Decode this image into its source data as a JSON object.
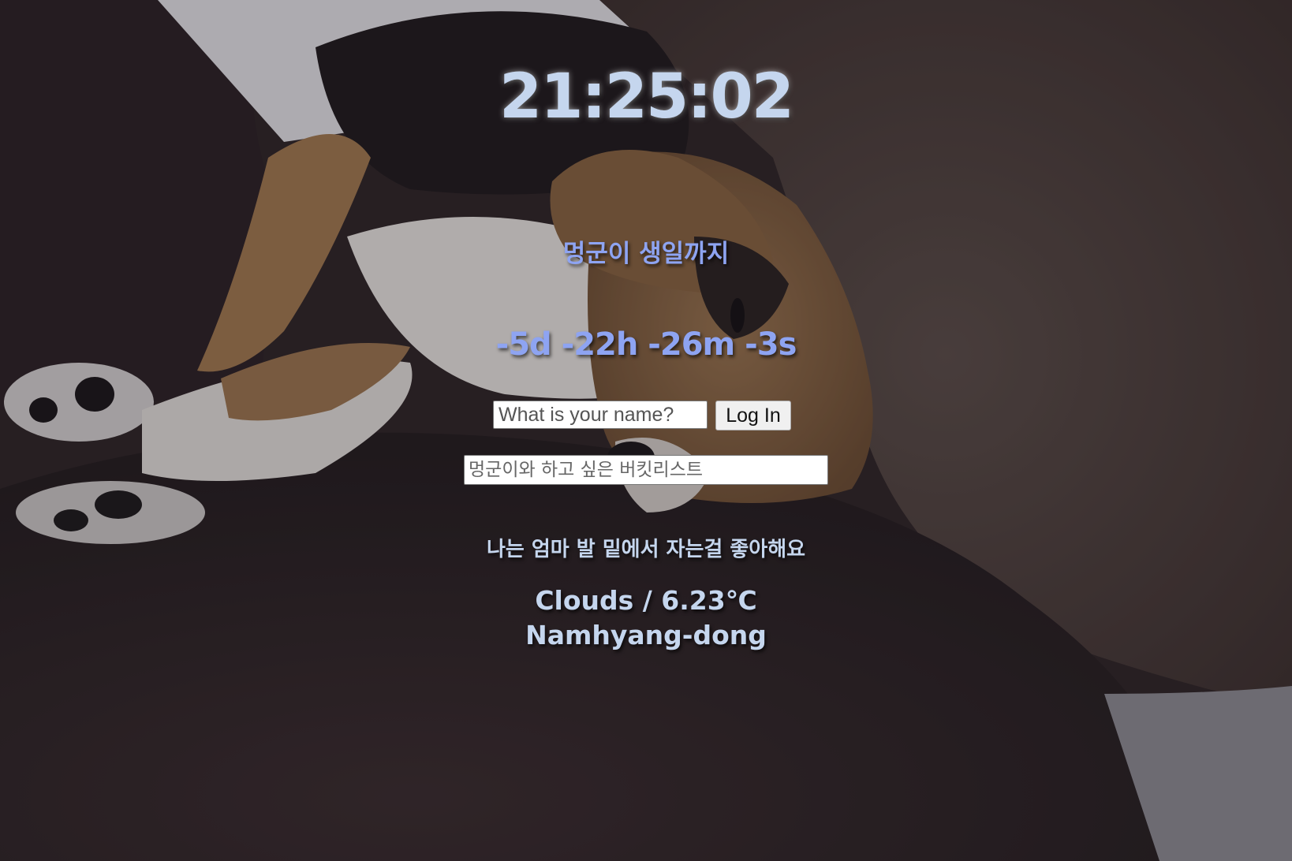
{
  "clock": {
    "time": "21:25:02"
  },
  "dday": {
    "title": "멍군이 생일까지",
    "countdown": "-5d -22h -26m -3s"
  },
  "login": {
    "placeholder": "What is your name?",
    "button_label": "Log In"
  },
  "todo": {
    "placeholder": "멍군이와 하고 싶은 버킷리스트"
  },
  "quote": {
    "text": "나는 엄마 발 밑에서 자는걸 좋아해요"
  },
  "weather": {
    "condition_temp": "Clouds / 6.23℃",
    "location": "Namhyang-dong"
  },
  "background": {
    "description_icon": "dog-photo-background",
    "colors": {
      "leather": "#3a2b2c",
      "fur_tan": "#a27a52",
      "fur_white": "#e9e4e0",
      "fur_black": "#1e1a1c"
    }
  }
}
